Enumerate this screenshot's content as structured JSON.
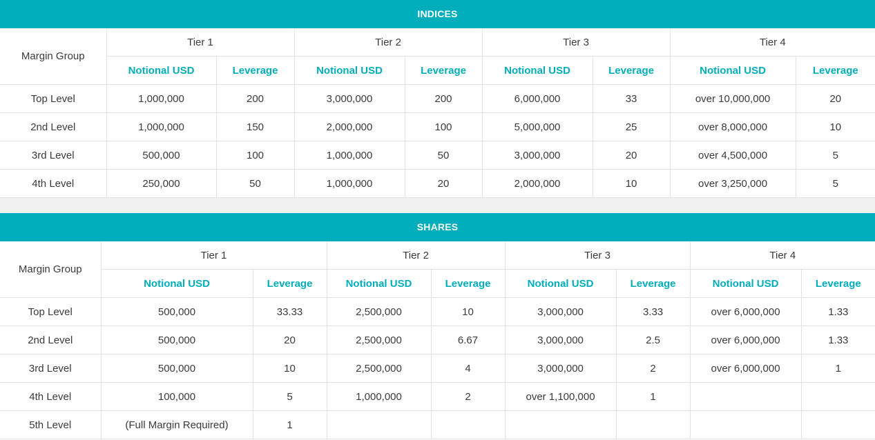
{
  "indices": {
    "title": "INDICES",
    "margin_group_label": "Margin Group",
    "tiers": [
      "Tier 1",
      "Tier 2",
      "Tier 3",
      "Tier 4"
    ],
    "notional_label": "Notional USD",
    "leverage_label": "Leverage",
    "rows": [
      {
        "group": "Top Level",
        "cells": [
          "1,000,000",
          "200",
          "3,000,000",
          "200",
          "6,000,000",
          "33",
          "over 10,000,000",
          "20"
        ]
      },
      {
        "group": "2nd Level",
        "cells": [
          "1,000,000",
          "150",
          "2,000,000",
          "100",
          "5,000,000",
          "25",
          "over 8,000,000",
          "10"
        ]
      },
      {
        "group": "3rd Level",
        "cells": [
          "500,000",
          "100",
          "1,000,000",
          "50",
          "3,000,000",
          "20",
          "over 4,500,000",
          "5"
        ]
      },
      {
        "group": "4th Level",
        "cells": [
          "250,000",
          "50",
          "1,000,000",
          "20",
          "2,000,000",
          "10",
          "over 3,250,000",
          "5"
        ]
      }
    ]
  },
  "shares": {
    "title": "SHARES",
    "margin_group_label": "Margin Group",
    "tiers": [
      "Tier 1",
      "Tier 2",
      "Tier 3",
      "Tier 4"
    ],
    "notional_label": "Notional USD",
    "leverage_label": "Leverage",
    "rows": [
      {
        "group": "Top Level",
        "cells": [
          "500,000",
          "33.33",
          "2,500,000",
          "10",
          "3,000,000",
          "3.33",
          "over 6,000,000",
          "1.33"
        ]
      },
      {
        "group": "2nd Level",
        "cells": [
          "500,000",
          "20",
          "2,500,000",
          "6.67",
          "3,000,000",
          "2.5",
          "over 6,000,000",
          "1.33"
        ]
      },
      {
        "group": "3rd Level",
        "cells": [
          "500,000",
          "10",
          "2,500,000",
          "4",
          "3,000,000",
          "2",
          "over 6,000,000",
          "1"
        ]
      },
      {
        "group": "4th Level",
        "cells": [
          "100,000",
          "5",
          "1,000,000",
          "2",
          "over 1,100,000",
          "1",
          "",
          ""
        ]
      },
      {
        "group": "5th Level",
        "cells": [
          "(Full Margin Required)",
          "1",
          "",
          "",
          "",
          "",
          "",
          ""
        ]
      }
    ]
  }
}
